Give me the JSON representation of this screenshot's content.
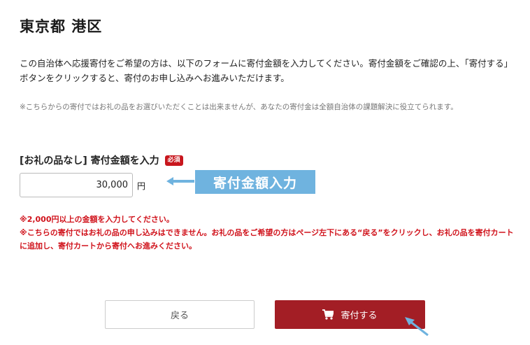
{
  "page": {
    "title": "東京都 港区",
    "intro": "この自治体へ応援寄付をご希望の方は、以下のフォームに寄付金額を入力してください。寄付金額をご確認の上、「寄付する」ボタンをクリックすると、寄付のお申し込みへお進みいただけます。",
    "note": "※こちらからの寄付ではお礼の品をお選びいただくことは出来ませんが、あなたの寄付金は全額自治体の課題解決に役立てられます。"
  },
  "form": {
    "label": "[お礼の品なし] 寄付金額を入力",
    "required_badge": "必須",
    "amount_value": "30,000",
    "unit": "円",
    "callout": "寄付金額入力",
    "warning_1": "※2,000円以上の金額を入力してください。",
    "warning_2": "※こちらの寄付ではお礼の品の申し込みはできません。お礼の品をご希望の方はページ左下にある“戻る”をクリックし、お礼の品を寄付カートに追加し、寄付カートから寄付へお進みください。"
  },
  "actions": {
    "back_label": "戻る",
    "donate_label": "寄付する"
  },
  "colors": {
    "primary": "#a31e25",
    "required": "#c8161d",
    "warning": "#d0121b",
    "callout": "#6fb3df"
  },
  "icons": {
    "donate": "cart-icon",
    "callout": "left-arrow-icon",
    "pointer": "cursor-arrow-icon"
  }
}
